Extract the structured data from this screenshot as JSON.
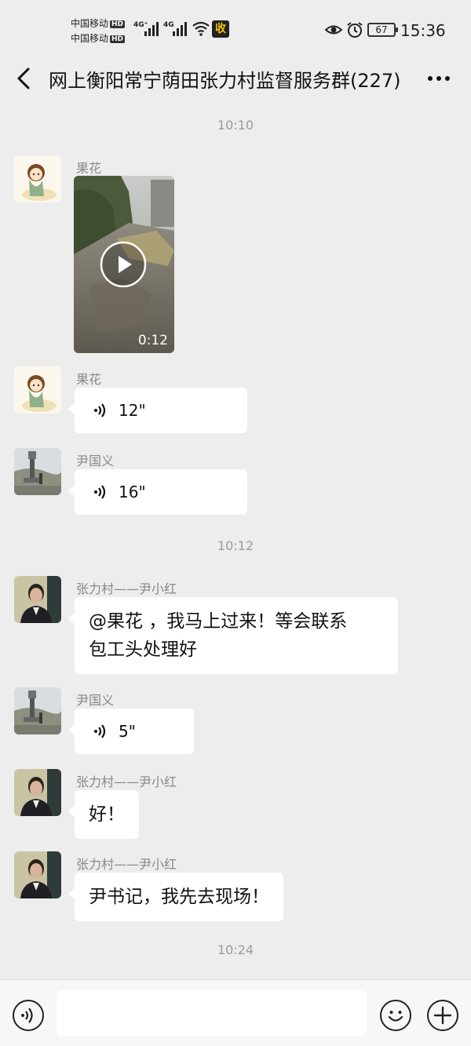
{
  "status_bar": {
    "carrier1": "中国移动",
    "carrier2": "中国移动",
    "hd_label": "HD",
    "net1": "4G⁺",
    "net2": "4G",
    "app_badge": "收",
    "battery": "67",
    "time": "15:36"
  },
  "header": {
    "title": "网上衡阳常宁荫田张力村监督服务群(227)"
  },
  "chat": {
    "ts1": "10:10",
    "ts2": "10:12",
    "ts3": "10:24",
    "messages": [
      {
        "sender": "果花",
        "type": "video",
        "duration": "0:12"
      },
      {
        "sender": "果花",
        "type": "voice",
        "duration": "12\""
      },
      {
        "sender": "尹国义",
        "type": "voice",
        "duration": "16\""
      },
      {
        "sender": "张力村——尹小红",
        "type": "text",
        "line1": "@果花 ，我马上过来！等会联系",
        "line2": "包工头处理好"
      },
      {
        "sender": "尹国义",
        "type": "voice",
        "duration": "5\""
      },
      {
        "sender": "张力村——尹小红",
        "type": "text",
        "text": "好！"
      },
      {
        "sender": "张力村——尹小红",
        "type": "text",
        "text": "尹书记，我先去现场！"
      }
    ]
  },
  "input_bar": {
    "value": "",
    "icons": [
      "voice-input-icon",
      "emoji-icon",
      "add-icon"
    ]
  },
  "colors": {
    "background": "#ededed",
    "bubble": "#ffffff",
    "timestamp": "#9a9a9a",
    "sender": "#888888"
  }
}
